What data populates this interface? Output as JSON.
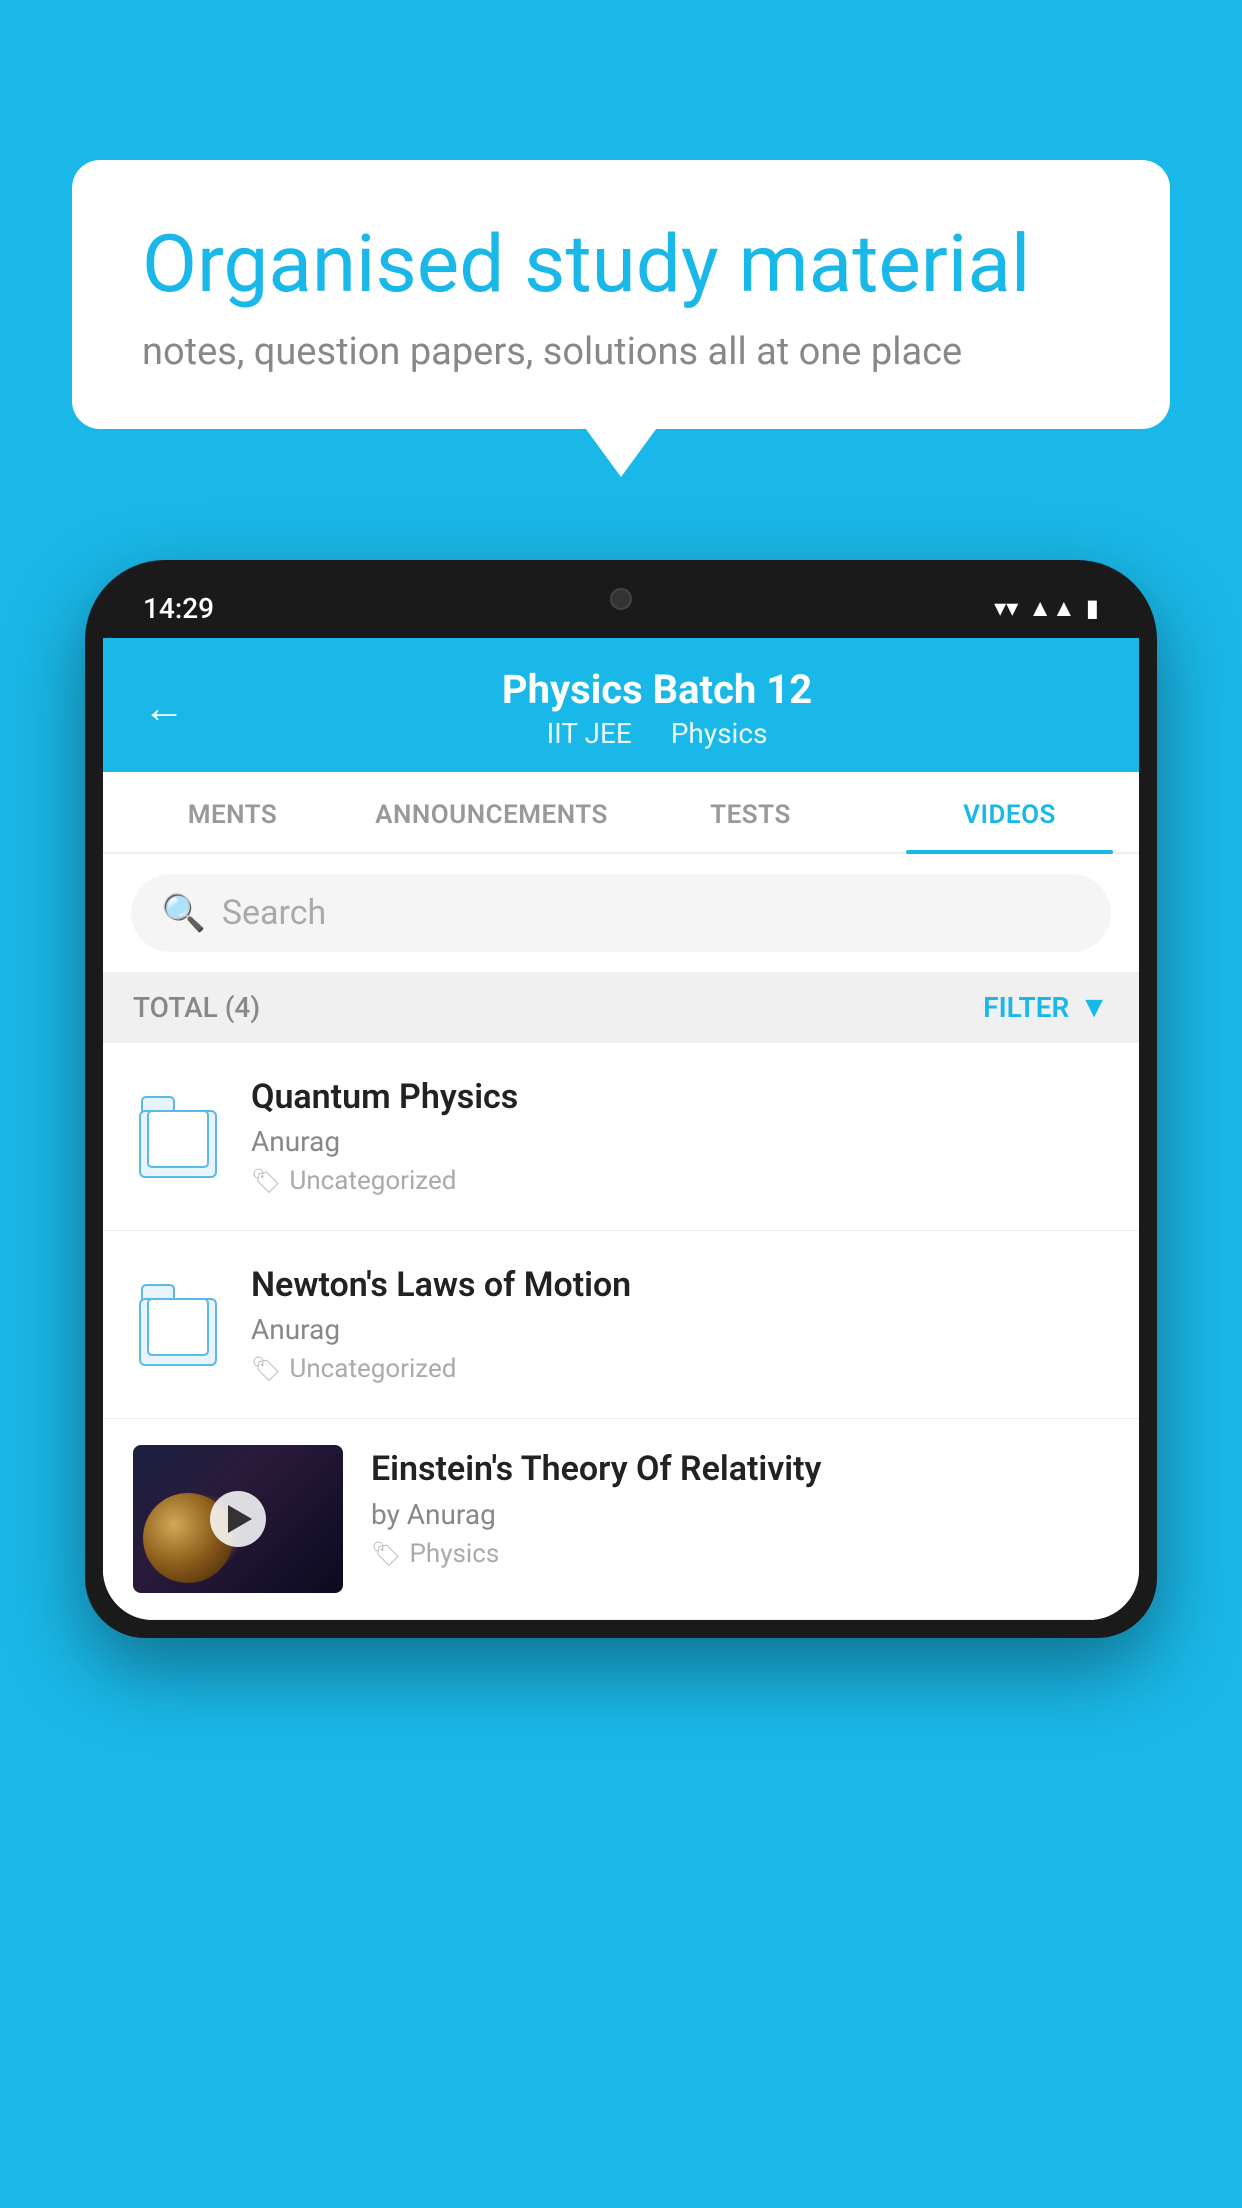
{
  "background_color": "#1ab8e8",
  "hero": {
    "title": "Organised study material",
    "subtitle": "notes, question papers, solutions all at one place"
  },
  "phone": {
    "status_bar": {
      "time": "14:29"
    },
    "header": {
      "title": "Physics Batch 12",
      "subtitle_part1": "IIT JEE",
      "subtitle_part2": "Physics",
      "back_label": "←"
    },
    "tabs": [
      {
        "label": "MENTS",
        "active": false
      },
      {
        "label": "ANNOUNCEMENTS",
        "active": false
      },
      {
        "label": "TESTS",
        "active": false
      },
      {
        "label": "VIDEOS",
        "active": true
      }
    ],
    "search": {
      "placeholder": "Search"
    },
    "filter_bar": {
      "total_label": "TOTAL (4)",
      "filter_label": "FILTER"
    },
    "videos": [
      {
        "id": 1,
        "title": "Quantum Physics",
        "author": "Anurag",
        "tag": "Uncategorized",
        "has_thumbnail": false
      },
      {
        "id": 2,
        "title": "Newton's Laws of Motion",
        "author": "Anurag",
        "tag": "Uncategorized",
        "has_thumbnail": false
      },
      {
        "id": 3,
        "title": "Einstein's Theory Of Relativity",
        "author": "by Anurag",
        "tag": "Physics",
        "has_thumbnail": true
      }
    ]
  }
}
